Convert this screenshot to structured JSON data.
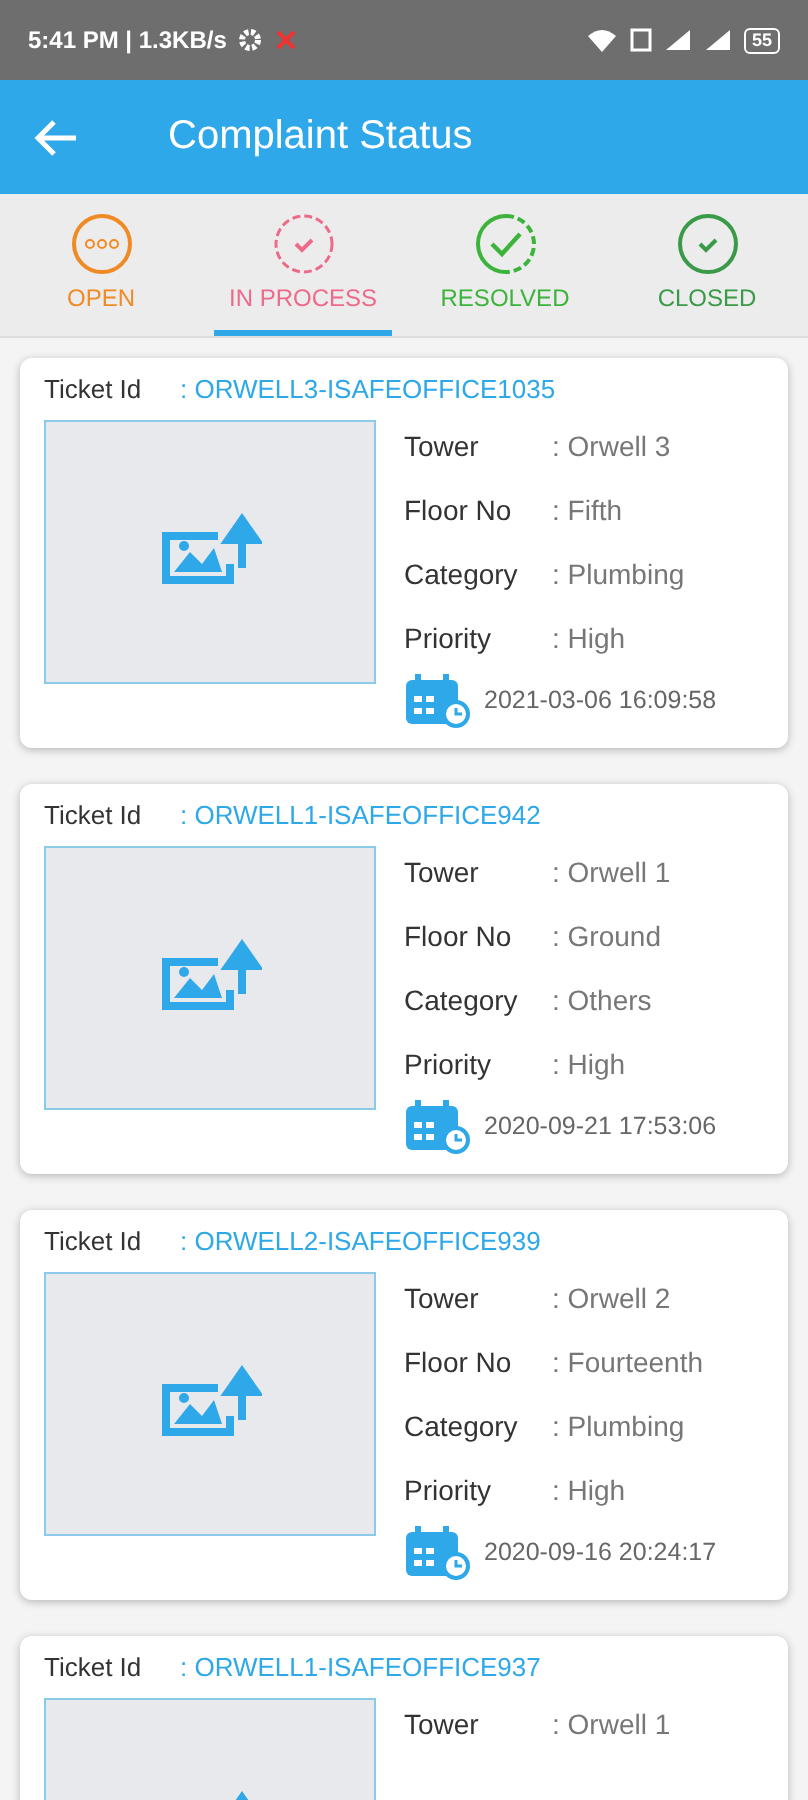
{
  "status_bar": {
    "time": "5:41 PM | 1.3KB/s",
    "battery": "55"
  },
  "app_bar": {
    "title": "Complaint Status"
  },
  "tabs": [
    {
      "label": "OPEN",
      "kind": "dots",
      "color": "#f08a24",
      "selected": false
    },
    {
      "label": "IN PROCESS",
      "kind": "dashed",
      "color": "#ee6a8a",
      "selected": true
    },
    {
      "label": "RESOLVED",
      "kind": "half",
      "color": "#3cb43c",
      "selected": false
    },
    {
      "label": "CLOSED",
      "kind": "check",
      "color": "#3a9a48",
      "selected": false
    }
  ],
  "tickets": [
    {
      "label": "Ticket Id",
      "id": ": ORWELL3-ISAFEOFFICE1035",
      "fields": [
        {
          "label": "Tower",
          "value": ": Orwell 3"
        },
        {
          "label": "Floor No",
          "value": ": Fifth"
        },
        {
          "label": "Category",
          "value": ": Plumbing"
        },
        {
          "label": "Priority",
          "value": ": High"
        }
      ],
      "date": "2021-03-06 16:09:58"
    },
    {
      "label": "Ticket Id",
      "id": ": ORWELL1-ISAFEOFFICE942",
      "fields": [
        {
          "label": "Tower",
          "value": ": Orwell 1"
        },
        {
          "label": "Floor No",
          "value": ": Ground"
        },
        {
          "label": "Category",
          "value": ": Others"
        },
        {
          "label": "Priority",
          "value": ": High"
        }
      ],
      "date": "2020-09-21 17:53:06"
    },
    {
      "label": "Ticket Id",
      "id": ": ORWELL2-ISAFEOFFICE939",
      "fields": [
        {
          "label": "Tower",
          "value": ": Orwell 2"
        },
        {
          "label": "Floor No",
          "value": ": Fourteenth"
        },
        {
          "label": "Category",
          "value": ": Plumbing"
        },
        {
          "label": "Priority",
          "value": ": High"
        }
      ],
      "date": "2020-09-16 20:24:17"
    },
    {
      "label": "Ticket Id",
      "id": ": ORWELL1-ISAFEOFFICE937",
      "fields": [
        {
          "label": "Tower",
          "value": ": Orwell 1"
        }
      ]
    }
  ]
}
